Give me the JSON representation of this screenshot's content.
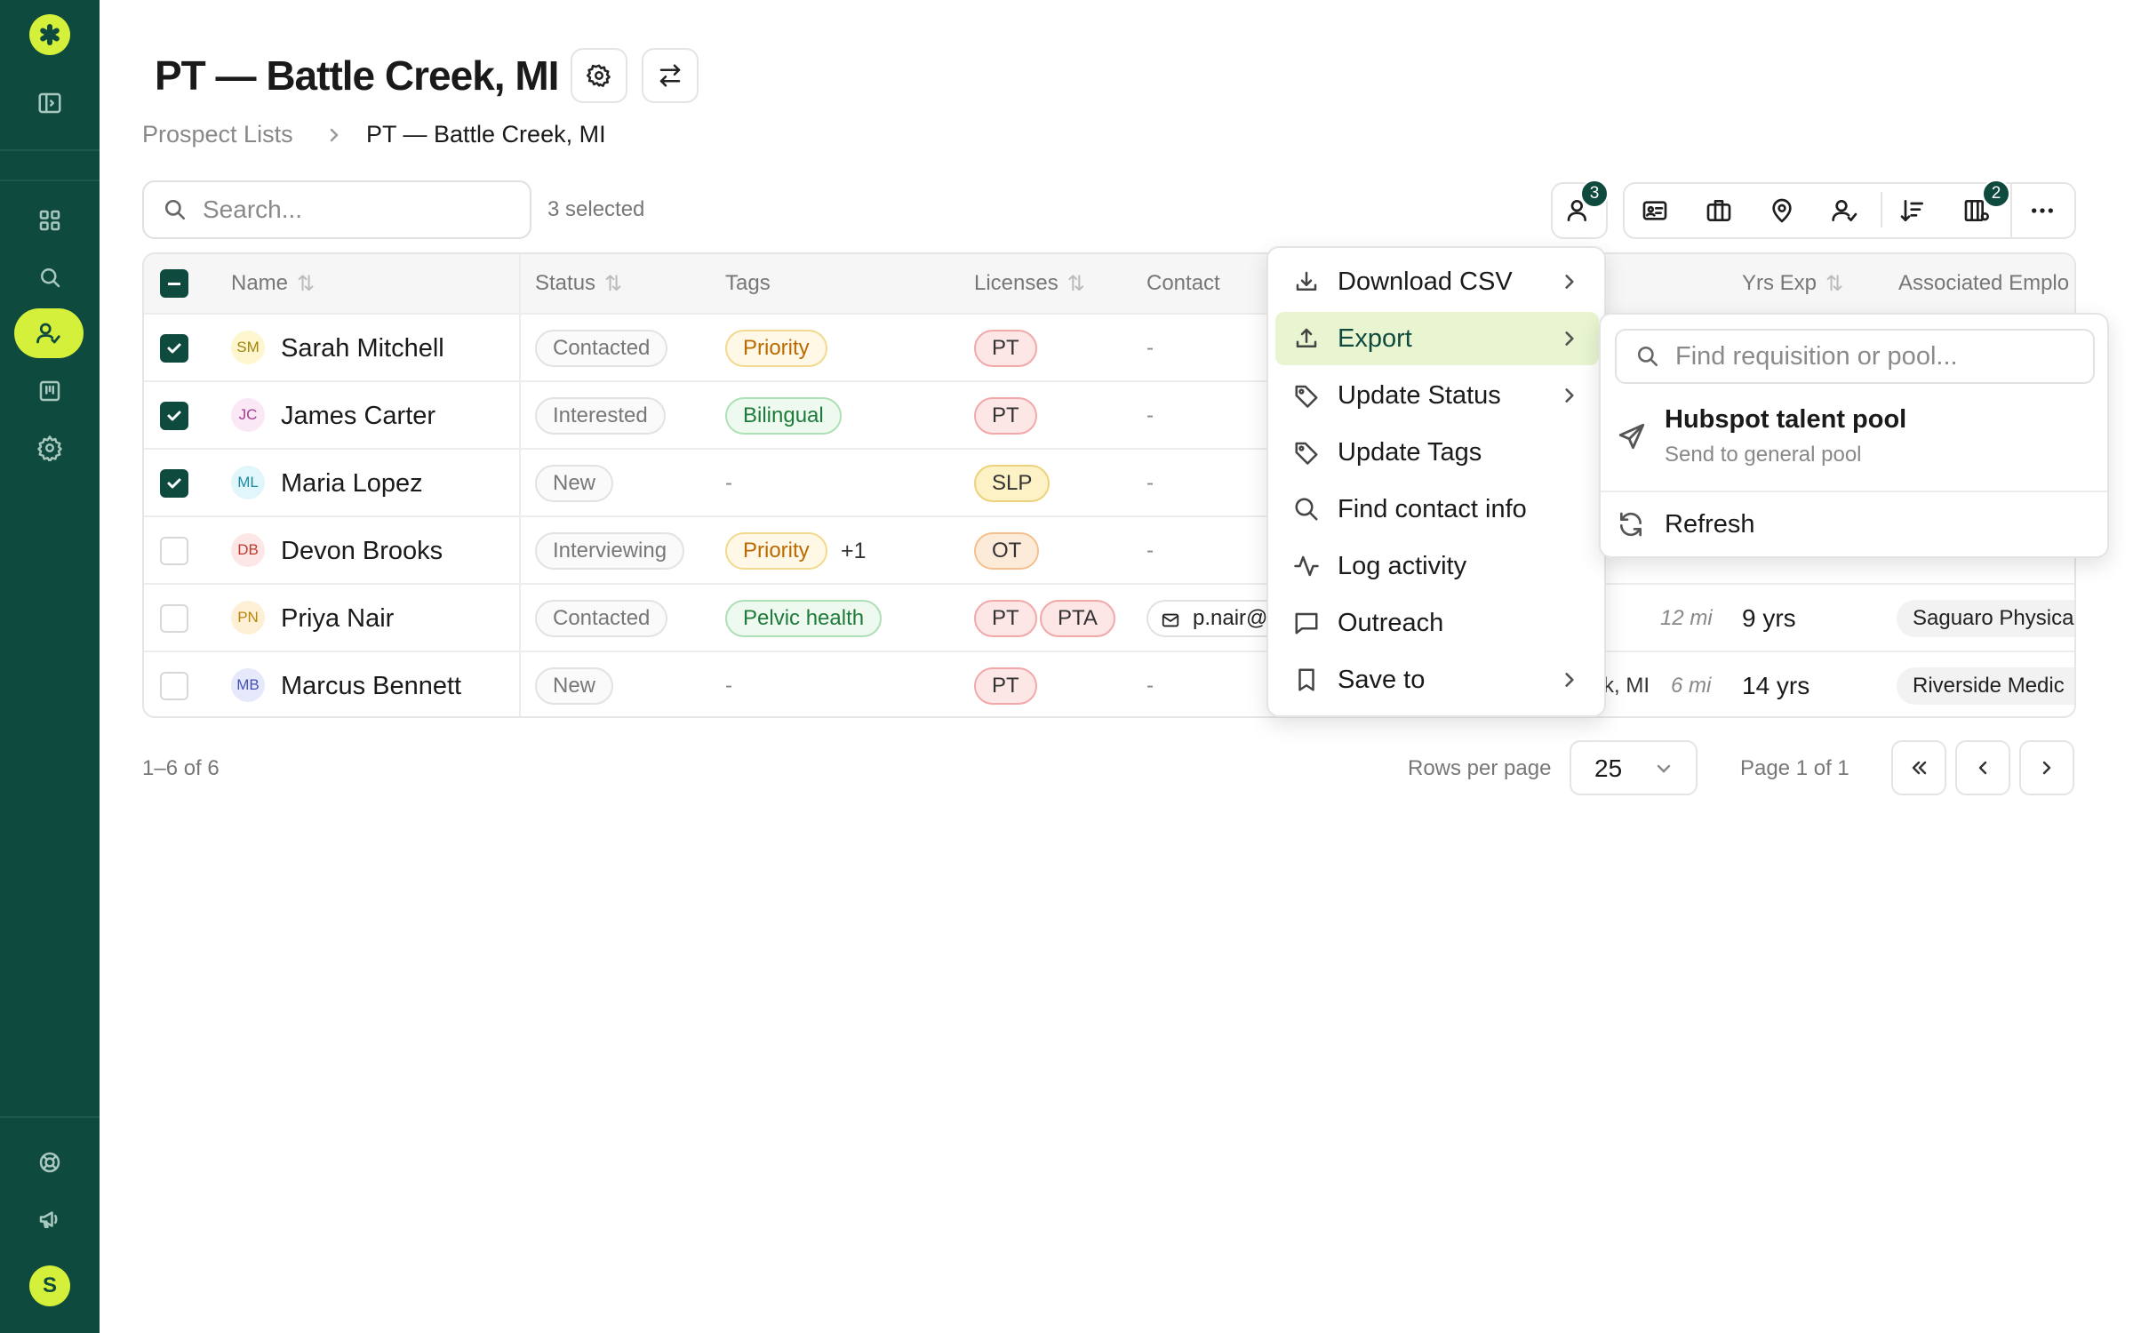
{
  "page": {
    "title": "PT — Battle Creek, MI"
  },
  "breadcrumb": {
    "root": "Prospect Lists",
    "current": "PT — Battle Creek, MI"
  },
  "search": {
    "placeholder": "Search..."
  },
  "selection": {
    "text": "3 selected"
  },
  "toolbar": {
    "people_badge": "3",
    "columns_badge": "2"
  },
  "columns": {
    "name": "Name",
    "status": "Status",
    "tags": "Tags",
    "licenses": "Licenses",
    "contact": "Contact",
    "yrs_exp": "Yrs Exp",
    "employer": "Associated Emplo"
  },
  "rows": [
    {
      "initials": "SM",
      "name": "Sarah Mitchell",
      "status": "Contacted",
      "tag": "Priority",
      "tag_extra": "",
      "licenses": [
        "PT"
      ],
      "contact": "-",
      "checked": true
    },
    {
      "initials": "JC",
      "name": "James Carter",
      "status": "Interested",
      "tag": "Bilingual",
      "tag_extra": "",
      "licenses": [
        "PT"
      ],
      "contact": "-",
      "checked": true
    },
    {
      "initials": "ML",
      "name": "Maria Lopez",
      "status": "New",
      "tag": "-",
      "tag_extra": "",
      "licenses": [
        "SLP"
      ],
      "contact": "-",
      "checked": true
    },
    {
      "initials": "DB",
      "name": "Devon Brooks",
      "status": "Interviewing",
      "tag": "Priority",
      "tag_extra": "+1",
      "licenses": [
        "OT"
      ],
      "contact": "-",
      "checked": false
    },
    {
      "initials": "PN",
      "name": "Priya Nair",
      "status": "Contacted",
      "tag": "Pelvic health",
      "tag_extra": "",
      "licenses": [
        "PT",
        "PTA"
      ],
      "contact": "p.nair@",
      "distance": "12 mi",
      "yrs": "9 yrs",
      "employer": "Saguaro Physica",
      "checked": false
    },
    {
      "initials": "MB",
      "name": "Marcus Bennett",
      "status": "New",
      "tag": "-",
      "tag_extra": "",
      "licenses": [
        "PT"
      ],
      "contact": "-",
      "location": "k, MI",
      "distance": "6 mi",
      "yrs": "14 yrs",
      "employer": "Riverside Medic",
      "checked": false
    }
  ],
  "menu": {
    "download_csv": "Download CSV",
    "export": "Export",
    "update_status": "Update Status",
    "update_tags": "Update Tags",
    "find_contact": "Find contact info",
    "log_activity": "Log activity",
    "outreach": "Outreach",
    "save_to": "Save to"
  },
  "submenu": {
    "search_placeholder": "Find requisition or pool...",
    "pool_title": "Hubspot talent pool",
    "pool_subtitle": "Send to general pool",
    "refresh": "Refresh"
  },
  "pagination": {
    "range": "1–6 of 6",
    "rows_per_page_label": "Rows per page",
    "rows_per_page": "25",
    "page": "Page 1 of 1"
  },
  "sidebar": {
    "avatar_initial": "S"
  },
  "colors": {
    "brand": "#0f4a3f",
    "accent": "#d4f03a"
  }
}
